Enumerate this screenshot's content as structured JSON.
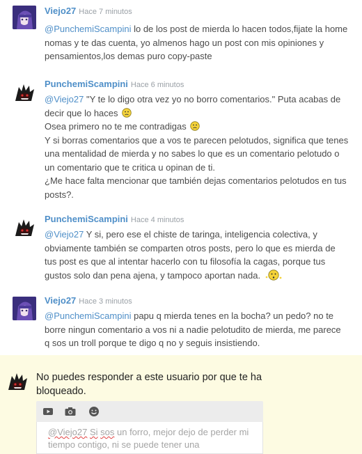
{
  "comments": [
    {
      "user": "Viejo27",
      "time": "Hace 7 minutos",
      "mention": "@PunchemiScampini",
      "text_1": " lo de los post de mierda lo hacen todos,fijate la home",
      "text_2": "nomas y te das cuenta, yo almenos hago un post con mis opiniones y",
      "text_3": "pensamientos,los demas puro copy-paste"
    },
    {
      "user": "PunchemiScampini",
      "time": "Hace 6 minutos",
      "mention": "@Viejo27",
      "line_1": " \"Y te lo digo otra vez yo no borro comentarios.\" Puta acabas de",
      "line_2": "decir que lo haces",
      "line_3": "Osea primero no te me contradigas",
      "line_4": "Y si borras comentarios que a vos te parecen pelotudos, significa que tenes",
      "line_5": "una mentalidad de mierda y no sabes lo que es un comentario pelotudo o",
      "line_6": "un comentario que te critica u opinan de ti.",
      "line_7": "¿Me hace falta mencionar que también dejas comentarios pelotudos en tus",
      "line_8": "posts?."
    },
    {
      "user": "PunchemiScampini",
      "time": "Hace 4 minutos",
      "mention": "@Viejo27",
      "line_1": " Y si, pero ese el chiste de taringa, inteligencia colectiva, y",
      "line_2": "obviamente también se comparten otros posts, pero lo que es mierda de",
      "line_3": "tus post es que al intentar hacerlo con tu filosofía la cagas, porque tus",
      "line_4": "gustos solo dan pena ajena, y tampoco aportan nada."
    },
    {
      "user": "Viejo27",
      "time": "Hace 3 minutos",
      "mention": "@PunchemiScampini",
      "line_1": " papu q mierda tenes en la bocha? un pedo? no te",
      "line_2": "borre ningun comentario a vos ni a nadie pelotudito de mierda, me parece",
      "line_3": "q sos un troll porque te digo q no y seguis insistiendo."
    }
  ],
  "blocked": {
    "message": "No puedes responder a este usuario por que te ha bloqueado.",
    "reply_mention": "@Viejo27",
    "reply_word_1": "Si",
    "reply_word_2": "sos",
    "reply_rest_1": " un forro, mejor dejo de perder mi",
    "reply_line_2": "tiempo contigo, ni se puede tener una conversación"
  },
  "icons": [
    "video-icon",
    "camera-icon",
    "emoji-icon"
  ],
  "colors": {
    "link": "#4f8fc8",
    "blocked_bg": "#fdfbe2",
    "toolbar_bg": "#ececec"
  }
}
